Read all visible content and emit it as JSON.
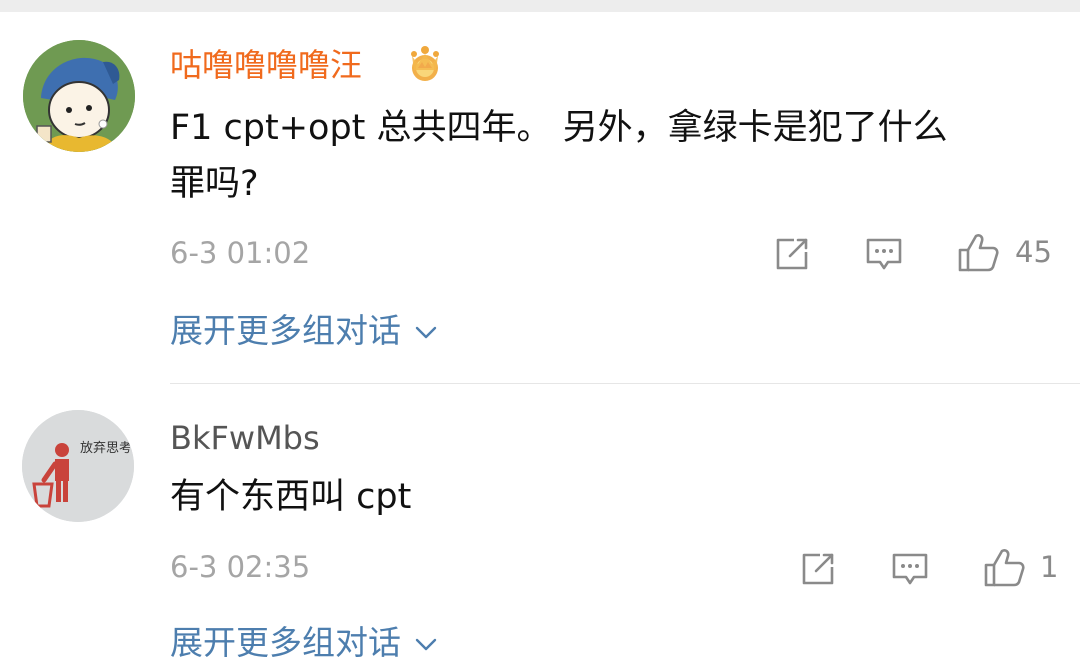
{
  "comments": [
    {
      "username": "咕噜噜噜噜汪",
      "content_line1": "F1 cpt+opt 总共四年。 另外，拿绿卡是犯了什么",
      "content_line2": "罪吗?",
      "timestamp": "6-3 01:02",
      "likes": "45",
      "expand_label": "展开更多组对话",
      "avatar_icon": "girl-with-pearl-earring-cartoon-avatar",
      "badge_icon": "vip-crown-icon"
    },
    {
      "username": "BkFwMbs",
      "content": "有个东西叫 cpt",
      "timestamp": "6-3 02:35",
      "likes": "1",
      "expand_label": "展开更多组对话",
      "avatar_icon": "trash-bin-figure-avatar",
      "avatar_text": "放弃思考"
    }
  ],
  "colors": {
    "username_vip": "#f06a1d",
    "username_normal": "#555555",
    "link": "#4d7eae",
    "meta": "#a5a5a5",
    "text": "#111111"
  }
}
